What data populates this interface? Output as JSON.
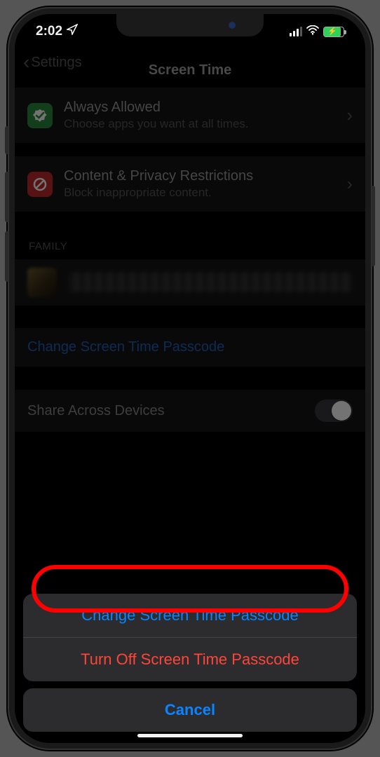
{
  "status": {
    "time": "2:02"
  },
  "nav": {
    "back": "Settings",
    "title": "Screen Time"
  },
  "cells": {
    "always": {
      "title": "Always Allowed",
      "sub": "Choose apps you want at all times."
    },
    "content": {
      "title": "Content & Privacy Restrictions",
      "sub": "Block inappropriate content."
    }
  },
  "section_family": "FAMILY",
  "change_passcode_link": "Change Screen Time Passcode",
  "share_row": "Share Across Devices",
  "sheet": {
    "change": "Change Screen Time Passcode",
    "off": "Turn Off Screen Time Passcode",
    "cancel": "Cancel"
  }
}
